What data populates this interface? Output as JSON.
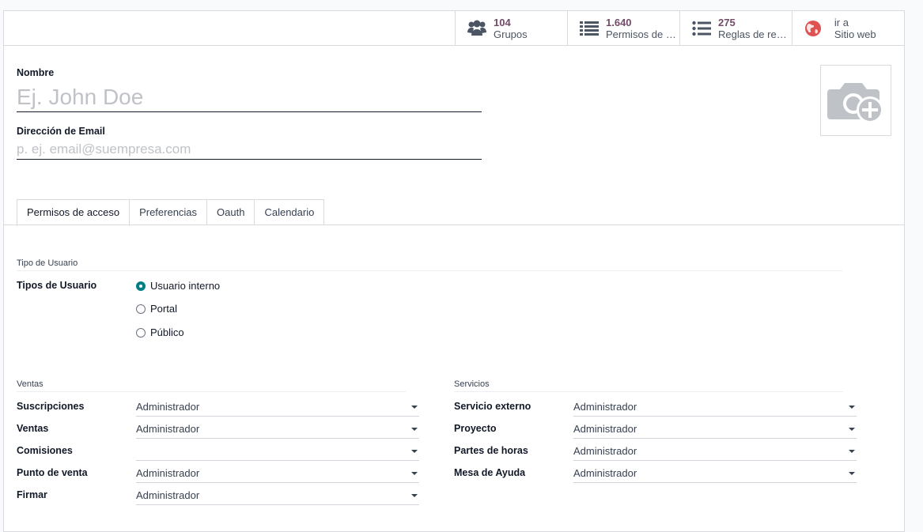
{
  "stat_buttons": [
    {
      "value": "104",
      "label": "Grupos",
      "icon": "users-icon"
    },
    {
      "value": "1.640",
      "label": "Permisos de acceso",
      "icon": "list-icon"
    },
    {
      "value": "275",
      "label": "Reglas de registro",
      "icon": "list-bullet-icon"
    },
    {
      "value": "ir a",
      "label": "Sitio web",
      "icon": "globe-icon"
    }
  ],
  "form": {
    "name_label": "Nombre",
    "name_placeholder": "Ej. John Doe",
    "email_label": "Dirección de Email",
    "email_placeholder": "p. ej. email@suempresa.com"
  },
  "tabs": [
    "Permisos de acceso",
    "Preferencias",
    "Oauth",
    "Calendario"
  ],
  "user_type": {
    "section_title": "Tipo de Usuario",
    "field_label": "Tipos de Usuario",
    "options": [
      "Usuario interno",
      "Portal",
      "Público"
    ],
    "selected": "Usuario interno"
  },
  "sales": {
    "section_title": "Ventas",
    "rows": [
      {
        "label": "Suscripciones",
        "value": "Administrador"
      },
      {
        "label": "Ventas",
        "value": "Administrador"
      },
      {
        "label": "Comisiones",
        "value": ""
      },
      {
        "label": "Punto de venta",
        "value": "Administrador"
      },
      {
        "label": "Firmar",
        "value": "Administrador"
      }
    ]
  },
  "services": {
    "section_title": "Servicios",
    "rows": [
      {
        "label": "Servicio externo",
        "value": "Administrador"
      },
      {
        "label": "Proyecto",
        "value": "Administrador"
      },
      {
        "label": "Partes de horas",
        "value": "Administrador"
      },
      {
        "label": "Mesa de Ayuda",
        "value": "Administrador"
      }
    ]
  },
  "colors": {
    "accent": "#714b67",
    "radio": "#017e84",
    "globe": "#e05151"
  }
}
